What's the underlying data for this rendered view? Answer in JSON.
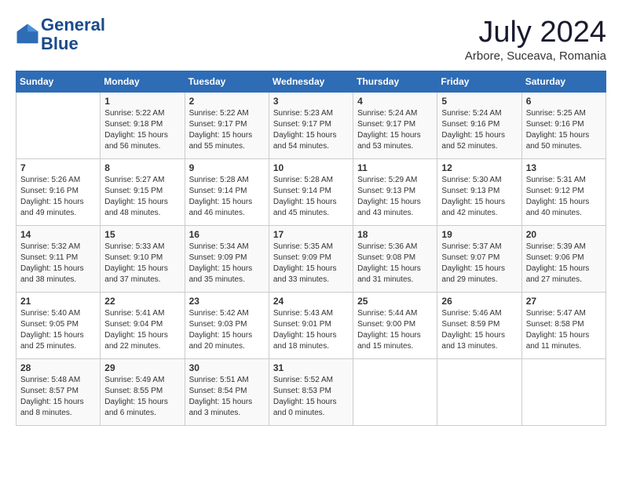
{
  "header": {
    "logo_line1": "General",
    "logo_line2": "Blue",
    "month": "July 2024",
    "location": "Arbore, Suceava, Romania"
  },
  "weekdays": [
    "Sunday",
    "Monday",
    "Tuesday",
    "Wednesday",
    "Thursday",
    "Friday",
    "Saturday"
  ],
  "weeks": [
    [
      {
        "day": "",
        "sunrise": "",
        "sunset": "",
        "daylight": ""
      },
      {
        "day": "1",
        "sunrise": "Sunrise: 5:22 AM",
        "sunset": "Sunset: 9:18 PM",
        "daylight": "Daylight: 15 hours and 56 minutes."
      },
      {
        "day": "2",
        "sunrise": "Sunrise: 5:22 AM",
        "sunset": "Sunset: 9:17 PM",
        "daylight": "Daylight: 15 hours and 55 minutes."
      },
      {
        "day": "3",
        "sunrise": "Sunrise: 5:23 AM",
        "sunset": "Sunset: 9:17 PM",
        "daylight": "Daylight: 15 hours and 54 minutes."
      },
      {
        "day": "4",
        "sunrise": "Sunrise: 5:24 AM",
        "sunset": "Sunset: 9:17 PM",
        "daylight": "Daylight: 15 hours and 53 minutes."
      },
      {
        "day": "5",
        "sunrise": "Sunrise: 5:24 AM",
        "sunset": "Sunset: 9:16 PM",
        "daylight": "Daylight: 15 hours and 52 minutes."
      },
      {
        "day": "6",
        "sunrise": "Sunrise: 5:25 AM",
        "sunset": "Sunset: 9:16 PM",
        "daylight": "Daylight: 15 hours and 50 minutes."
      }
    ],
    [
      {
        "day": "7",
        "sunrise": "Sunrise: 5:26 AM",
        "sunset": "Sunset: 9:16 PM",
        "daylight": "Daylight: 15 hours and 49 minutes."
      },
      {
        "day": "8",
        "sunrise": "Sunrise: 5:27 AM",
        "sunset": "Sunset: 9:15 PM",
        "daylight": "Daylight: 15 hours and 48 minutes."
      },
      {
        "day": "9",
        "sunrise": "Sunrise: 5:28 AM",
        "sunset": "Sunset: 9:14 PM",
        "daylight": "Daylight: 15 hours and 46 minutes."
      },
      {
        "day": "10",
        "sunrise": "Sunrise: 5:28 AM",
        "sunset": "Sunset: 9:14 PM",
        "daylight": "Daylight: 15 hours and 45 minutes."
      },
      {
        "day": "11",
        "sunrise": "Sunrise: 5:29 AM",
        "sunset": "Sunset: 9:13 PM",
        "daylight": "Daylight: 15 hours and 43 minutes."
      },
      {
        "day": "12",
        "sunrise": "Sunrise: 5:30 AM",
        "sunset": "Sunset: 9:13 PM",
        "daylight": "Daylight: 15 hours and 42 minutes."
      },
      {
        "day": "13",
        "sunrise": "Sunrise: 5:31 AM",
        "sunset": "Sunset: 9:12 PM",
        "daylight": "Daylight: 15 hours and 40 minutes."
      }
    ],
    [
      {
        "day": "14",
        "sunrise": "Sunrise: 5:32 AM",
        "sunset": "Sunset: 9:11 PM",
        "daylight": "Daylight: 15 hours and 38 minutes."
      },
      {
        "day": "15",
        "sunrise": "Sunrise: 5:33 AM",
        "sunset": "Sunset: 9:10 PM",
        "daylight": "Daylight: 15 hours and 37 minutes."
      },
      {
        "day": "16",
        "sunrise": "Sunrise: 5:34 AM",
        "sunset": "Sunset: 9:09 PM",
        "daylight": "Daylight: 15 hours and 35 minutes."
      },
      {
        "day": "17",
        "sunrise": "Sunrise: 5:35 AM",
        "sunset": "Sunset: 9:09 PM",
        "daylight": "Daylight: 15 hours and 33 minutes."
      },
      {
        "day": "18",
        "sunrise": "Sunrise: 5:36 AM",
        "sunset": "Sunset: 9:08 PM",
        "daylight": "Daylight: 15 hours and 31 minutes."
      },
      {
        "day": "19",
        "sunrise": "Sunrise: 5:37 AM",
        "sunset": "Sunset: 9:07 PM",
        "daylight": "Daylight: 15 hours and 29 minutes."
      },
      {
        "day": "20",
        "sunrise": "Sunrise: 5:39 AM",
        "sunset": "Sunset: 9:06 PM",
        "daylight": "Daylight: 15 hours and 27 minutes."
      }
    ],
    [
      {
        "day": "21",
        "sunrise": "Sunrise: 5:40 AM",
        "sunset": "Sunset: 9:05 PM",
        "daylight": "Daylight: 15 hours and 25 minutes."
      },
      {
        "day": "22",
        "sunrise": "Sunrise: 5:41 AM",
        "sunset": "Sunset: 9:04 PM",
        "daylight": "Daylight: 15 hours and 22 minutes."
      },
      {
        "day": "23",
        "sunrise": "Sunrise: 5:42 AM",
        "sunset": "Sunset: 9:03 PM",
        "daylight": "Daylight: 15 hours and 20 minutes."
      },
      {
        "day": "24",
        "sunrise": "Sunrise: 5:43 AM",
        "sunset": "Sunset: 9:01 PM",
        "daylight": "Daylight: 15 hours and 18 minutes."
      },
      {
        "day": "25",
        "sunrise": "Sunrise: 5:44 AM",
        "sunset": "Sunset: 9:00 PM",
        "daylight": "Daylight: 15 hours and 15 minutes."
      },
      {
        "day": "26",
        "sunrise": "Sunrise: 5:46 AM",
        "sunset": "Sunset: 8:59 PM",
        "daylight": "Daylight: 15 hours and 13 minutes."
      },
      {
        "day": "27",
        "sunrise": "Sunrise: 5:47 AM",
        "sunset": "Sunset: 8:58 PM",
        "daylight": "Daylight: 15 hours and 11 minutes."
      }
    ],
    [
      {
        "day": "28",
        "sunrise": "Sunrise: 5:48 AM",
        "sunset": "Sunset: 8:57 PM",
        "daylight": "Daylight: 15 hours and 8 minutes."
      },
      {
        "day": "29",
        "sunrise": "Sunrise: 5:49 AM",
        "sunset": "Sunset: 8:55 PM",
        "daylight": "Daylight: 15 hours and 6 minutes."
      },
      {
        "day": "30",
        "sunrise": "Sunrise: 5:51 AM",
        "sunset": "Sunset: 8:54 PM",
        "daylight": "Daylight: 15 hours and 3 minutes."
      },
      {
        "day": "31",
        "sunrise": "Sunrise: 5:52 AM",
        "sunset": "Sunset: 8:53 PM",
        "daylight": "Daylight: 15 hours and 0 minutes."
      },
      {
        "day": "",
        "sunrise": "",
        "sunset": "",
        "daylight": ""
      },
      {
        "day": "",
        "sunrise": "",
        "sunset": "",
        "daylight": ""
      },
      {
        "day": "",
        "sunrise": "",
        "sunset": "",
        "daylight": ""
      }
    ]
  ]
}
